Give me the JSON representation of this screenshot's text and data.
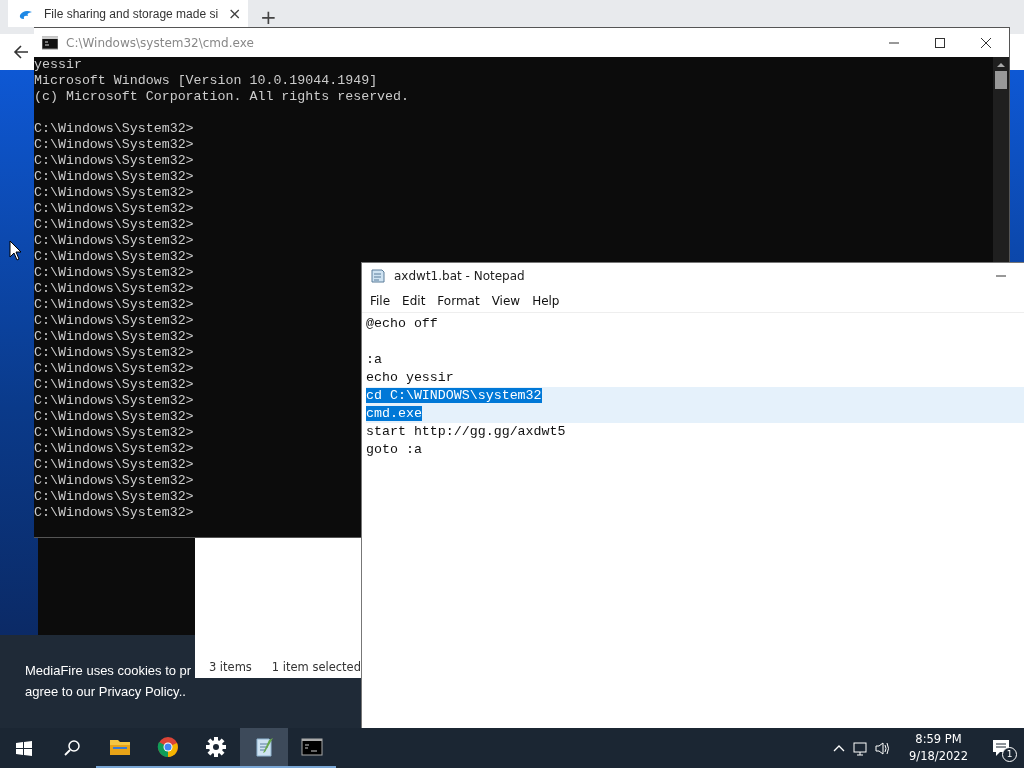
{
  "browser": {
    "tab_title": "File sharing and storage made si",
    "tab_close": "×",
    "new_tab": "+"
  },
  "cmd": {
    "title": "C:\\Windows\\system32\\cmd.exe",
    "banner": [
      "yessir",
      "Microsoft Windows [Version 10.0.19044.1949]",
      "(c) Microsoft Corporation. All rights reserved."
    ],
    "prompts": [
      "C:\\Windows\\System32>",
      "C:\\Windows\\System32>",
      "C:\\Windows\\System32>",
      "C:\\Windows\\System32>",
      "C:\\Windows\\System32>",
      "C:\\Windows\\System32>",
      "C:\\Windows\\System32>",
      "C:\\Windows\\System32>",
      "C:\\Windows\\System32>",
      "C:\\Windows\\System32>",
      "C:\\Windows\\System32>",
      "C:\\Windows\\System32>",
      "C:\\Windows\\System32>",
      "C:\\Windows\\System32>",
      "C:\\Windows\\System32>",
      "C:\\Windows\\System32>",
      "C:\\Windows\\System32>",
      "C:\\Windows\\System32>",
      "C:\\Windows\\System32>",
      "C:\\Windows\\System32>",
      "C:\\Windows\\System32>",
      "C:\\Windows\\System32>",
      "C:\\Windows\\System32>",
      "C:\\Windows\\System32>",
      "C:\\Windows\\System32>"
    ]
  },
  "cookie_banner": {
    "lines": [
      "MediaFire uses cookies to pr",
      "agree to our Privacy Policy.."
    ]
  },
  "explorer": {
    "status": [
      "3 items",
      "1 item selected"
    ]
  },
  "notepad": {
    "title": "axdwt1.bat - Notepad",
    "menu": [
      "File",
      "Edit",
      "Format",
      "View",
      "Help"
    ],
    "lines": [
      {
        "text": "@echo off",
        "selected": false
      },
      {
        "selected": false
      },
      {
        "text": ":a",
        "selected": false
      },
      {
        "text": "echo yessir",
        "selected": false
      },
      {
        "text": "cd C:\\WINDOWS\\system32",
        "selected": true
      },
      {
        "text": "cmd.exe",
        "selected": true
      },
      {
        "text": "start http://gg.gg/axdwt5",
        "selected": false
      },
      {
        "text": "goto :a",
        "selected": false
      }
    ]
  },
  "taskbar": {
    "apps": [
      {
        "kind": "explorer",
        "active": false
      },
      {
        "kind": "chrome",
        "active": false
      },
      {
        "kind": "settings",
        "active": false
      },
      {
        "kind": "notepad",
        "active": true
      },
      {
        "kind": "cmd",
        "active": false
      }
    ],
    "time": "8:59 PM",
    "date": "9/18/2022",
    "notification_count": "1"
  }
}
